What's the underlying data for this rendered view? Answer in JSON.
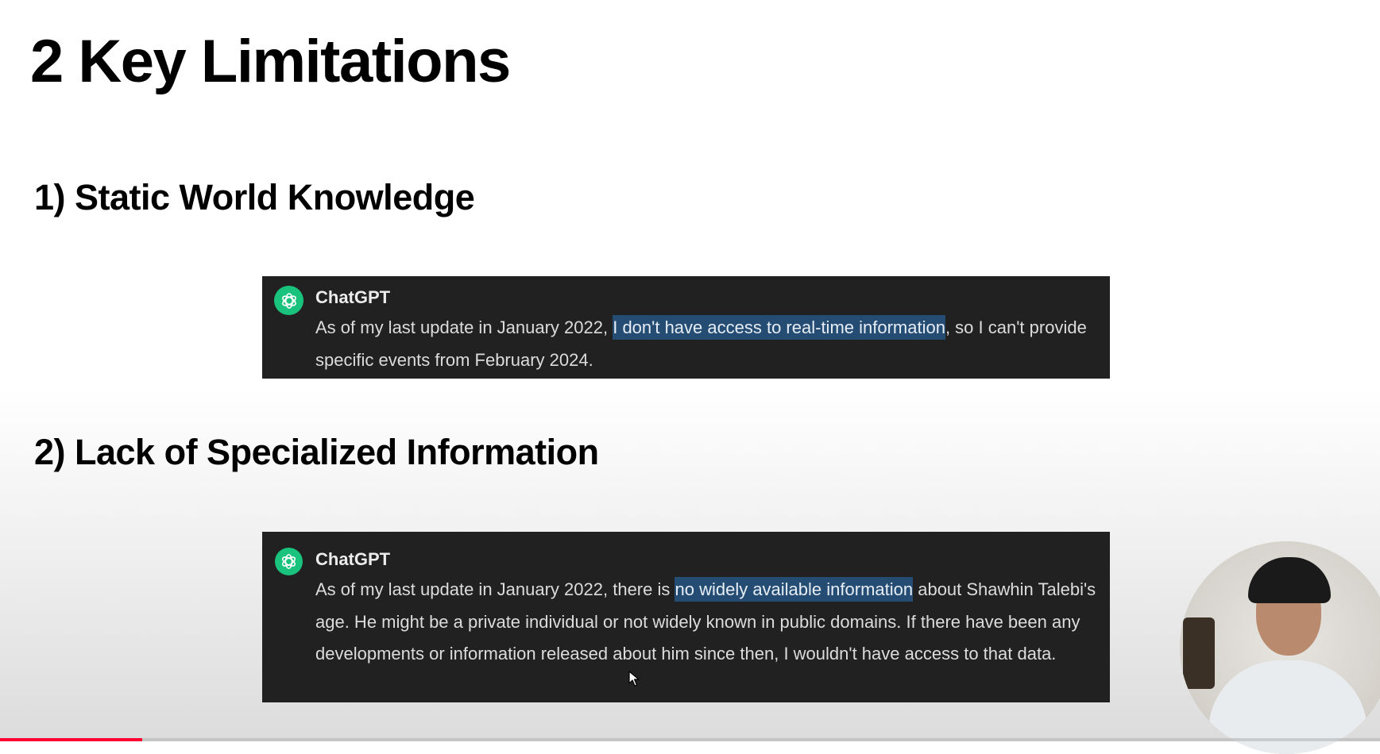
{
  "slide": {
    "title": "2 Key Limitations"
  },
  "sections": [
    {
      "heading": "1) Static World Knowledge",
      "chat": {
        "name": "ChatGPT",
        "text_before": "As of my last update in January 2022, ",
        "highlight": "I don't have access to real-time information",
        "text_after": ", so I can't provide specific events from February 2024."
      }
    },
    {
      "heading": "2) Lack of Specialized Information",
      "chat": {
        "name": "ChatGPT",
        "text_before": "As of my last update in January 2022, there is ",
        "highlight": "no widely available information",
        "text_after": " about Shawhin Talebi's age. He might be a private individual or not widely known in public domains. If there have been any developments or information released about him since then, I wouldn't have access to that data."
      }
    }
  ],
  "icons": {
    "chat_avatar": "openai-logo-icon",
    "cursor": "mouse-cursor-icon"
  },
  "video": {
    "progress_fraction": 0.103
  },
  "colors": {
    "chat_background": "#212121",
    "highlight": "#254d74",
    "avatar": "#19c37d",
    "progress": "#ff0033"
  }
}
